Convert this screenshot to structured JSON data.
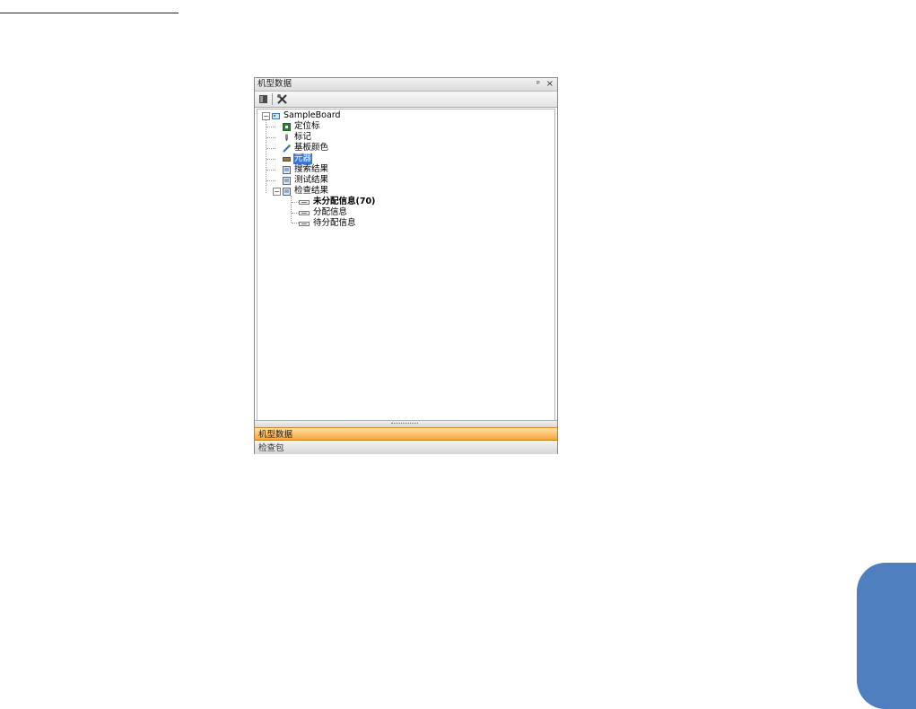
{
  "panel": {
    "title": "机型数据",
    "pin_glyph": "ᵖ",
    "close_glyph": "×"
  },
  "tree": {
    "root": "SampleBoard",
    "items": [
      {
        "label": "定位标"
      },
      {
        "label": "标记"
      },
      {
        "label": "基板颜色"
      },
      {
        "label": "元器"
      },
      {
        "label": "搜索结果"
      },
      {
        "label": "测试结果"
      },
      {
        "label": "检查结果"
      }
    ],
    "check_results_children": [
      {
        "label": "未分配信息(70)"
      },
      {
        "label": "分配信息"
      },
      {
        "label": "待分配信息"
      }
    ]
  },
  "nav_tabs": [
    {
      "label": "机型数据",
      "active": true
    },
    {
      "label": "检查包",
      "active": false
    }
  ],
  "colors": {
    "selection": "#3a78d8",
    "active_tab": "#f7a43a",
    "side_tab": "#4f7fbf"
  }
}
